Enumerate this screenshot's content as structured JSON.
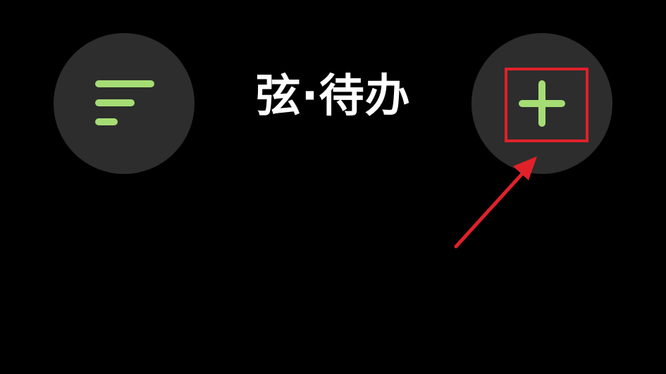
{
  "header": {
    "title": "弦·待办",
    "filter_button_icon": "filter-lines-icon",
    "add_button_icon": "plus-icon"
  },
  "colors": {
    "background": "#000000",
    "button_bg": "#2d2d2d",
    "accent": "#a5dd74",
    "title_text": "#ffffff",
    "annotation": "#e0212a"
  }
}
